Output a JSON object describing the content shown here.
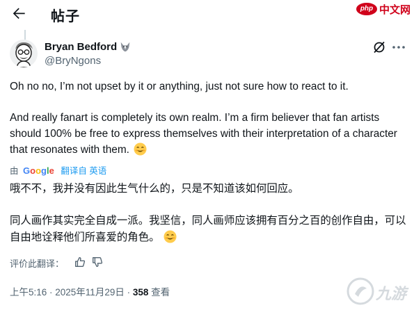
{
  "header": {
    "title": "帖子"
  },
  "watermark": {
    "php_text": "php",
    "cn_text": "中文网",
    "site_text": "九游"
  },
  "tweet": {
    "author_name": "Bryan Bedford",
    "author_handle": "@BryNgons",
    "paragraph1": "Oh no no, I’m not upset by it or anything, just not sure how to react to it.",
    "paragraph2": "And really fanart is completely its own realm. I’m a firm believer that fan artists should 100% be free to express themselves with their interpretation of a character that resonates with them."
  },
  "translation": {
    "by_label": "由",
    "provider_letters": [
      "G",
      "o",
      "o",
      "g",
      "l",
      "e"
    ],
    "link_label": "翻译自 英语",
    "line1": "哦不不，我并没有因此生气什么的，只是不知道该如何回应。",
    "line2": "同人画作其实完全自成一派。我坚信，同人画师应该拥有百分之百的创作自由，可以自由地诠释他们所喜爱的角色。",
    "rate_label": "评价此翻译："
  },
  "meta": {
    "time_date": "上午5:16 · 2025年11月29日 · ",
    "views_count": "358",
    "views_label": " 查看"
  },
  "icons": {
    "back": "back-arrow-icon",
    "verified": "fox-badge-icon",
    "grok": "grok-icon",
    "more": "more-dots-icon",
    "emoji": "smiling-face-emoji",
    "thumbs_up": "thumbs-up-icon",
    "thumbs_down": "thumbs-down-icon"
  },
  "colors": {
    "text": "#0f1419",
    "secondary": "#536471",
    "link": "#1d9bf0",
    "watermark_red": "#d0021b"
  }
}
